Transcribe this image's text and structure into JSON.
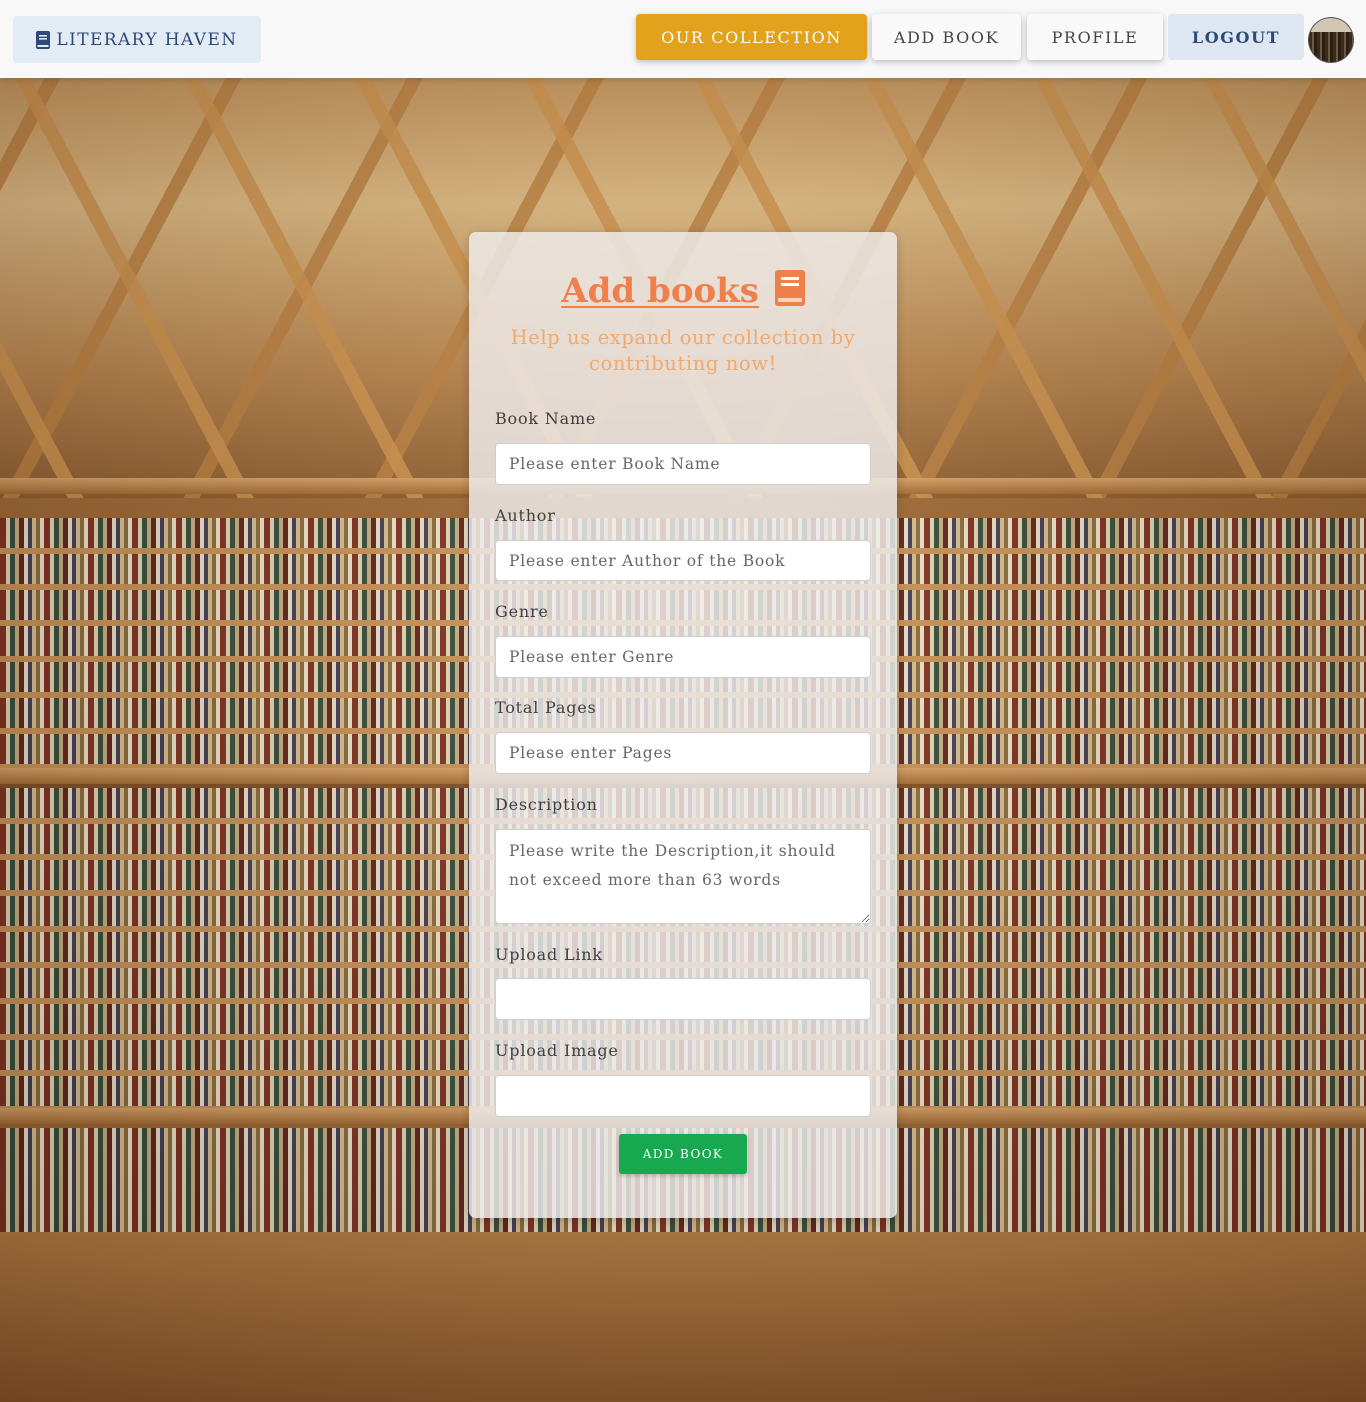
{
  "navbar": {
    "brand_label": "LITERARY HAVEN",
    "brand_icon": "book-icon",
    "links": {
      "collection": "OUR COLLECTION",
      "add_book": "ADD BOOK",
      "profile": "PROFILE",
      "logout": "LOGOUT"
    },
    "colors": {
      "collection_bg": "#e2a21b",
      "brand_text": "#2d4a78",
      "logout_bg": "#dee6f2"
    }
  },
  "form": {
    "title": "Add books",
    "title_icon": "book-icon",
    "subtitle": "Help us expand our collection by contributing now!",
    "fields": {
      "book_name": {
        "label": "Book Name",
        "placeholder": "Please enter Book Name",
        "value": ""
      },
      "author": {
        "label": "Author",
        "placeholder": "Please enter Author of the Book",
        "value": ""
      },
      "genre": {
        "label": "Genre",
        "placeholder": "Please enter Genre",
        "value": ""
      },
      "pages": {
        "label": "Total Pages",
        "placeholder": "Please enter Pages",
        "value": ""
      },
      "description": {
        "label": "Description",
        "placeholder": "Please write the Description,it should not exceed more than 63 words",
        "value": ""
      },
      "upload_link": {
        "label": "Upload Link",
        "placeholder": "",
        "value": ""
      },
      "upload_image": {
        "label": "Upload Image",
        "placeholder": "",
        "value": ""
      }
    },
    "submit_label": "ADD BOOK",
    "colors": {
      "title": "#ef7f4b",
      "subtitle": "#f4a96a",
      "submit_bg": "#18a84f"
    }
  }
}
